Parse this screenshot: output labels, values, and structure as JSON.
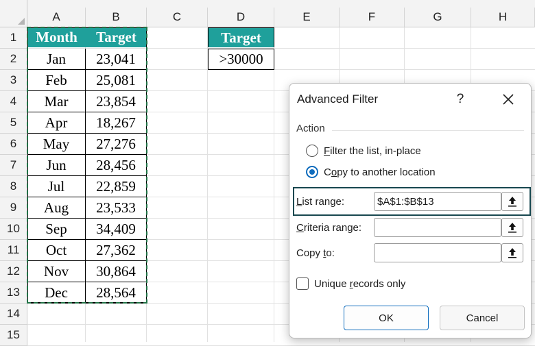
{
  "sheet": {
    "columns": [
      "A",
      "B",
      "C",
      "D",
      "E",
      "F",
      "G",
      "H"
    ],
    "rows": [
      "1",
      "2",
      "3",
      "4",
      "5",
      "6",
      "7",
      "8",
      "9",
      "10",
      "11",
      "12",
      "13",
      "14",
      "15"
    ],
    "table": {
      "headers": [
        "Month",
        "Target"
      ],
      "rows": [
        [
          "Jan",
          "23,041"
        ],
        [
          "Feb",
          "25,081"
        ],
        [
          "Mar",
          "23,854"
        ],
        [
          "Apr",
          "18,267"
        ],
        [
          "May",
          "27,276"
        ],
        [
          "Jun",
          "28,456"
        ],
        [
          "Jul",
          "22,859"
        ],
        [
          "Aug",
          "23,533"
        ],
        [
          "Sep",
          "34,409"
        ],
        [
          "Oct",
          "27,362"
        ],
        [
          "Nov",
          "30,864"
        ],
        [
          "Dec",
          "28,564"
        ]
      ]
    },
    "criteria": {
      "header": "Target",
      "value": ">30000"
    },
    "colors": {
      "header_fill": "#1fa09b",
      "marching_ants": "#217346"
    }
  },
  "dialog": {
    "title": "Advanced Filter",
    "help": "?",
    "action_label": "Action",
    "option_filter_in_place": {
      "underlined": "F",
      "rest": "ilter the list, in-place",
      "selected": false
    },
    "option_copy": {
      "before": "C",
      "underlined": "o",
      "rest": "py to another location",
      "selected": true
    },
    "list_range": {
      "underlined": "L",
      "rest": "ist range:",
      "value": "$A$1:$B$13"
    },
    "criteria_range": {
      "underlined": "C",
      "rest": "riteria range:",
      "value": ""
    },
    "copy_to": {
      "before": "Copy ",
      "underlined": "t",
      "rest": "o:",
      "value": ""
    },
    "unique": {
      "before": "Unique ",
      "underlined": "r",
      "rest": "ecords only",
      "checked": false
    },
    "ok_label": "OK",
    "cancel_label": "Cancel",
    "highlight_color": "#17474f"
  }
}
